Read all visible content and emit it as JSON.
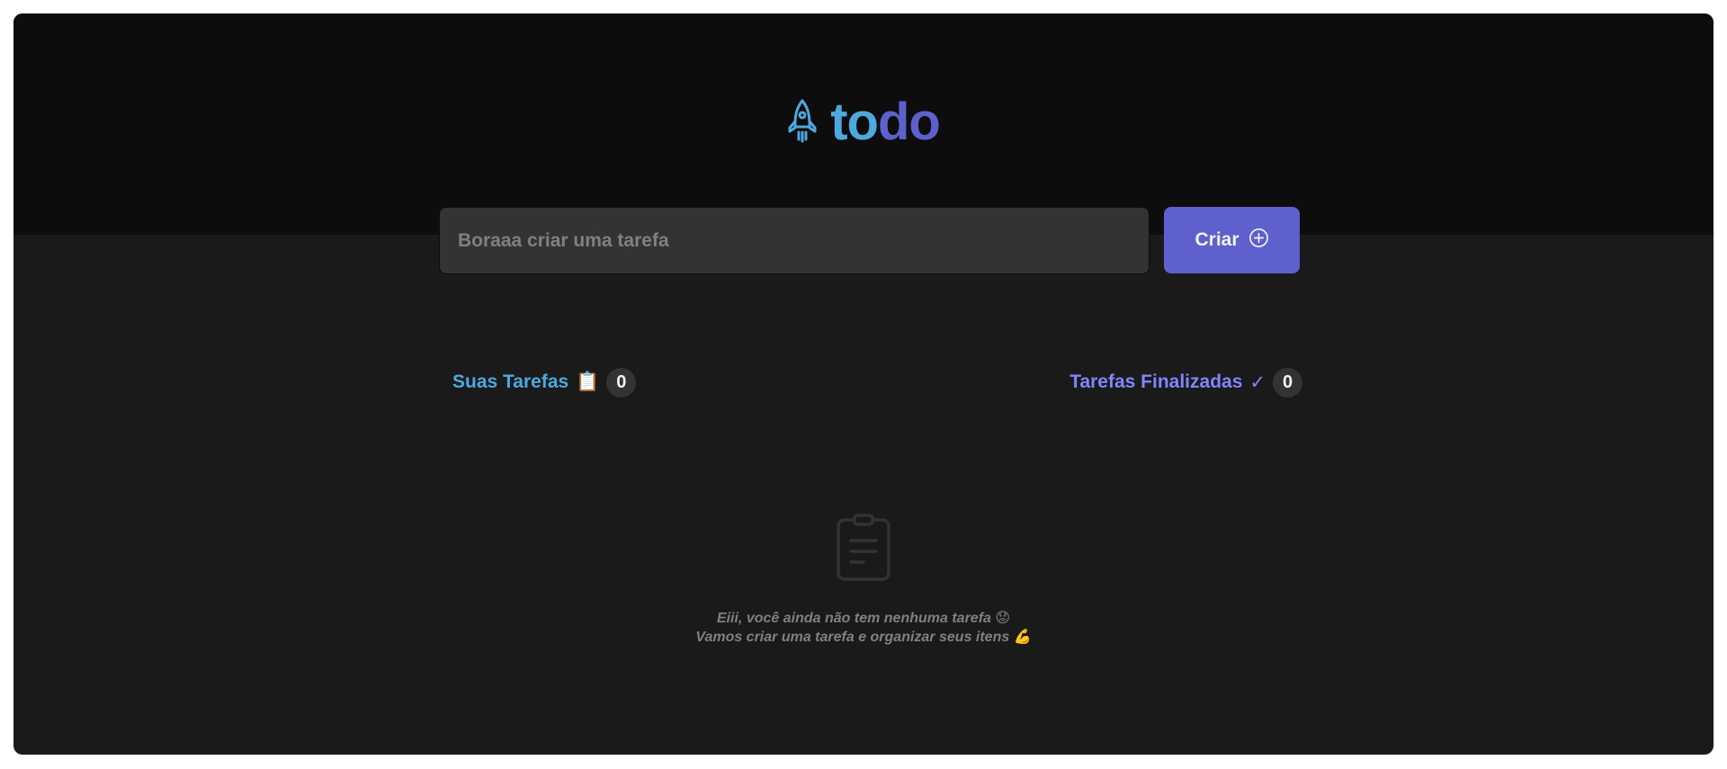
{
  "header": {
    "logo_icon": "rocket-icon",
    "logo_text_first": "to",
    "logo_text_second": "do",
    "colors": {
      "primary_blue": "#4ea8de",
      "primary_purple": "#5e60ce"
    }
  },
  "create": {
    "placeholder": "Boraaa criar uma tarefa",
    "value": "",
    "button_label": "Criar",
    "button_icon": "plus-circle-icon"
  },
  "counters": {
    "created": {
      "label": "Suas Tarefas",
      "glyph": "📋",
      "count": "0"
    },
    "done": {
      "label": "Tarefas Finalizadas",
      "glyph": "✓",
      "count": "0"
    }
  },
  "empty_state": {
    "icon": "clipboard-icon",
    "line1": "Eiii, você ainda não tem nenhuma tarefa 😟",
    "line2": "Vamos criar uma tarefa e organizar seus itens 💪"
  }
}
